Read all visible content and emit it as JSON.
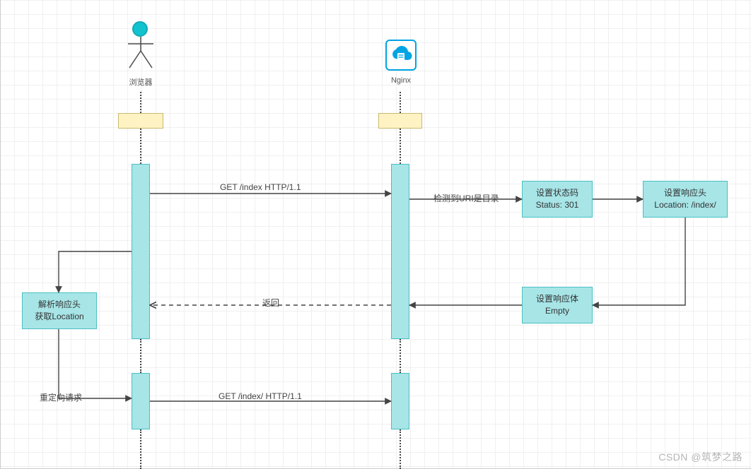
{
  "chart_data": {
    "type": "diagram",
    "diagram_kind": "sequence",
    "participants": [
      {
        "id": "browser",
        "label": "浏览器",
        "icon": "actor"
      },
      {
        "id": "nginx",
        "label": "Nginx",
        "icon": "cloud-server"
      }
    ],
    "messages": [
      {
        "from": "browser",
        "to": "nginx",
        "label": "GET /index HTTP/1.1",
        "style": "solid"
      },
      {
        "from": "nginx",
        "to": "status_box",
        "label": "检测到URI是目录",
        "style": "solid"
      },
      {
        "from": "status_box",
        "to": "header_box",
        "label": "",
        "style": "solid"
      },
      {
        "from": "header_box",
        "to": "body_box",
        "label": "",
        "style": "solid",
        "routing": "down-left"
      },
      {
        "from": "body_box",
        "to": "nginx",
        "label": "",
        "style": "solid"
      },
      {
        "from": "nginx",
        "to": "browser",
        "label": "返回",
        "style": "dashed"
      },
      {
        "from": "browser",
        "to": "parse_box",
        "label": "",
        "style": "solid",
        "self": true
      },
      {
        "from": "parse_box",
        "to": "browser",
        "label": "重定向请求",
        "style": "solid",
        "routing": "down-right"
      },
      {
        "from": "browser",
        "to": "nginx",
        "label": "GET /index/ HTTP/1.1",
        "style": "solid"
      }
    ],
    "process_boxes": {
      "status_box": {
        "line1": "设置状态码",
        "line2": "Status: 301"
      },
      "header_box": {
        "line1": "设置响应头",
        "line2": "Location: /index/"
      },
      "body_box": {
        "line1": "设置响应体",
        "line2": "Empty"
      },
      "parse_box": {
        "line1": "解析响应头",
        "line2": "获取Location"
      }
    }
  },
  "labels": {
    "browser": "浏览器",
    "nginx": "Nginx",
    "msg_get1": "GET /index HTTP/1.1",
    "msg_uri_dir": "检测到URI是目录",
    "status_l1": "设置状态码",
    "status_l2": "Status: 301",
    "header_l1": "设置响应头",
    "header_l2": "Location: /index/",
    "body_l1": "设置响应体",
    "body_l2": "Empty",
    "msg_return": "返回",
    "parse_l1": "解析响应头",
    "parse_l2": "获取Location",
    "msg_redirect": "重定向请求",
    "msg_get2": "GET /index/ HTTP/1.1"
  },
  "watermark": "CSDN @筑梦之路"
}
